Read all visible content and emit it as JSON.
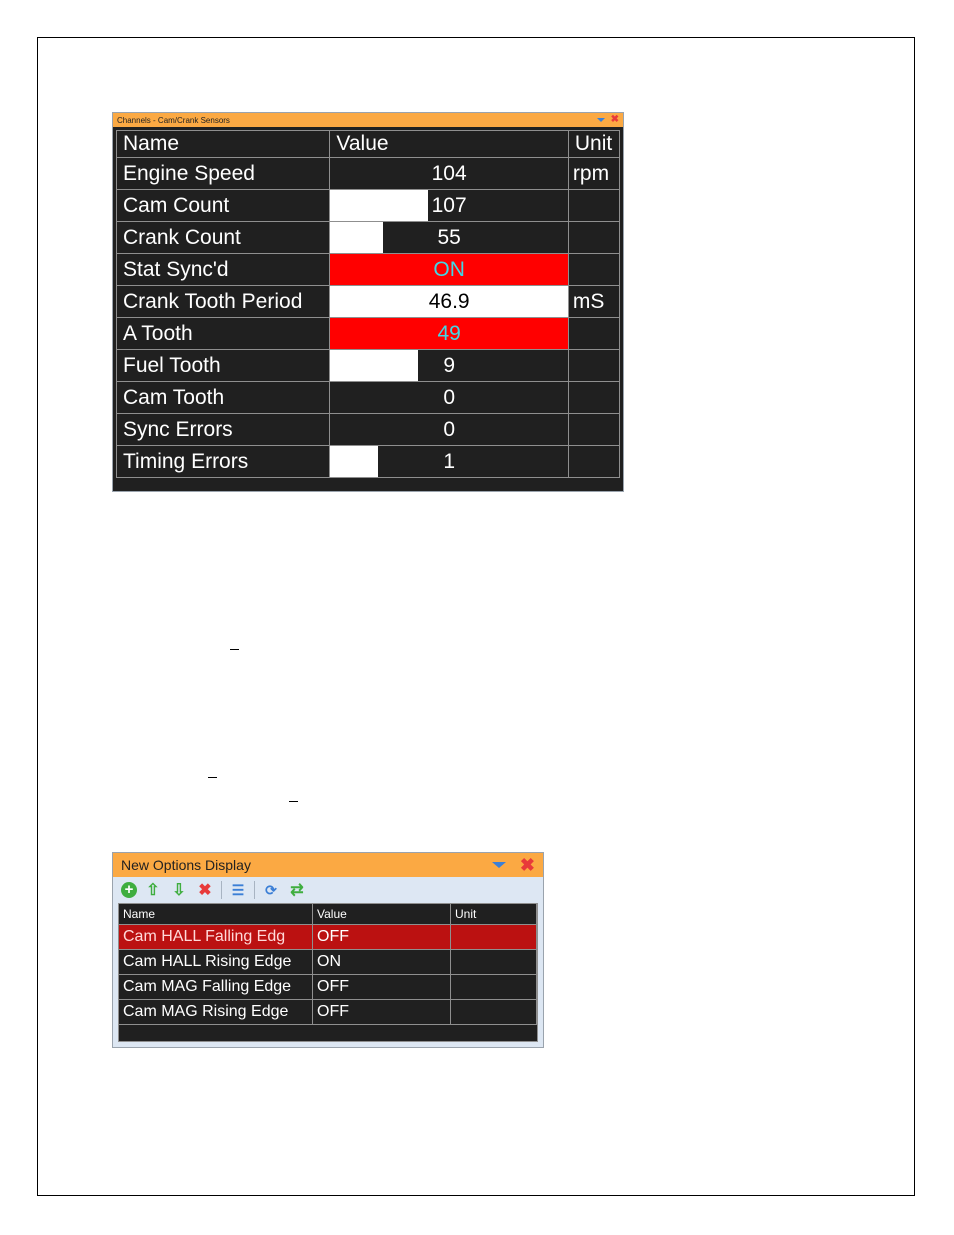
{
  "channels_panel": {
    "title": "Channels - Cam/Crank Sensors",
    "icons": [
      "dropdown-arrow-icon",
      "close-icon"
    ],
    "columns": [
      "Name",
      "Value",
      "Unit"
    ],
    "rows": [
      {
        "name": "Engine Speed",
        "value": "104",
        "unit": "rpm",
        "style": "plain",
        "bar_fraction": 0
      },
      {
        "name": "Cam Count",
        "value": "107",
        "unit": "",
        "style": "bar",
        "bar_fraction": 0.41
      },
      {
        "name": "Crank Count",
        "value": "55",
        "unit": "",
        "style": "bar",
        "bar_fraction": 0.22
      },
      {
        "name": "Stat Sync'd",
        "value": "ON",
        "unit": "",
        "style": "red",
        "bar_fraction": 0
      },
      {
        "name": "Crank Tooth Period",
        "value": "46.9",
        "unit": "mS",
        "style": "white",
        "bar_fraction": 1
      },
      {
        "name": "A Tooth",
        "value": "49",
        "unit": "",
        "style": "red",
        "bar_fraction": 0
      },
      {
        "name": "Fuel Tooth",
        "value": "9",
        "unit": "",
        "style": "bar",
        "bar_fraction": 0.37
      },
      {
        "name": "Cam Tooth",
        "value": "0",
        "unit": "",
        "style": "plain",
        "bar_fraction": 0
      },
      {
        "name": "Sync Errors",
        "value": "0",
        "unit": "",
        "style": "plain",
        "bar_fraction": 0
      },
      {
        "name": "Timing Errors",
        "value": "1",
        "unit": "",
        "style": "bar",
        "bar_fraction": 0.2
      }
    ],
    "colors": {
      "titlebar": "#fba943",
      "alarm": "#ff0000",
      "alarm_text": "#3fd8e6",
      "grid_bg": "#202020"
    }
  },
  "options_panel": {
    "title": "New Options Display",
    "toolbar": [
      {
        "icon": "add-icon",
        "glyph": "+"
      },
      {
        "icon": "move-up-icon",
        "glyph": "⇧"
      },
      {
        "icon": "move-down-icon",
        "glyph": "⇩"
      },
      {
        "icon": "delete-icon",
        "glyph": "✖"
      },
      {
        "icon": "list-icon",
        "glyph": "☰"
      },
      {
        "icon": "refresh-all-icon",
        "glyph": "⟳"
      },
      {
        "icon": "refresh-icon",
        "glyph": "⇄"
      }
    ],
    "columns": [
      "Name",
      "Value",
      "Unit"
    ],
    "rows": [
      {
        "name": "Cam HALL Falling Edg",
        "value": "OFF",
        "unit": "",
        "selected": true
      },
      {
        "name": "Cam HALL Rising Edge",
        "value": "ON",
        "unit": "",
        "selected": false
      },
      {
        "name": "Cam MAG Falling Edge",
        "value": "OFF",
        "unit": "",
        "selected": false
      },
      {
        "name": "Cam MAG Rising Edge",
        "value": "OFF",
        "unit": "",
        "selected": false
      }
    ],
    "colors": {
      "titlebar": "#fba943",
      "selected_row": "#bb1111"
    }
  }
}
